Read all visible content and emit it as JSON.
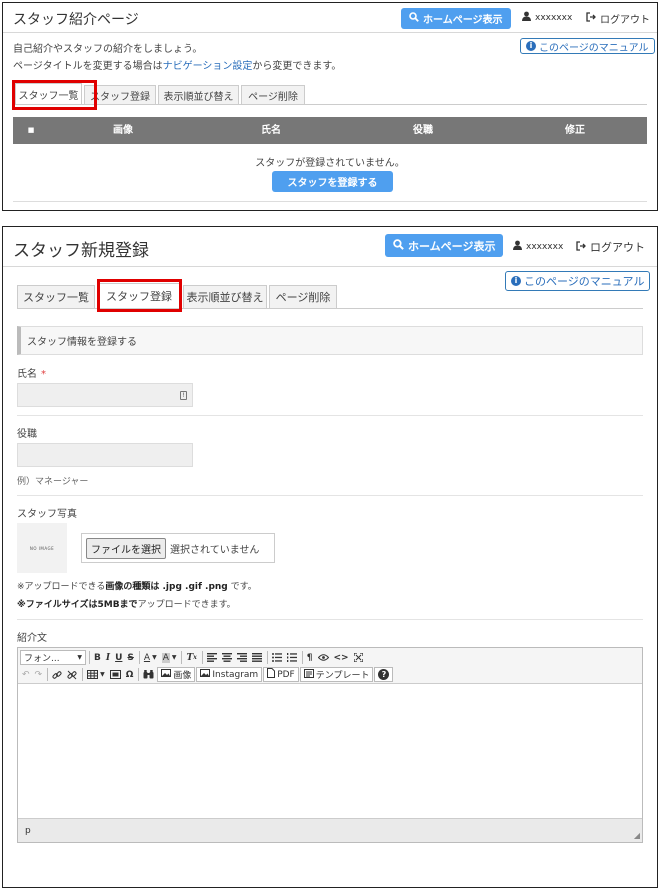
{
  "screen1": {
    "title": "スタッフ紹介ページ",
    "home_button": "ホームページ表示",
    "user": "xxxxxxx",
    "logout": "ログアウト",
    "manual": "このページのマニュアル",
    "desc1": "自己紹介やスタッフの紹介をしましょう。",
    "desc2_pre": "ページタイトルを変更する場合は",
    "desc2_link": "ナビゲーション設定",
    "desc2_post": "から変更できます。",
    "tabs": [
      "スタッフ一覧",
      "スタッフ登録",
      "表示順並び替え",
      "ページ削除"
    ],
    "active_tab": "スタッフ一覧",
    "table_headers": [
      "■",
      "画像",
      "氏名",
      "役職",
      "修正"
    ],
    "empty_message": "スタッフが登録されていません。",
    "register_button": "スタッフを登録する"
  },
  "screen2": {
    "title": "スタッフ新規登録",
    "home_button": "ホームページ表示",
    "user": "xxxxxxx",
    "logout": "ログアウト",
    "manual": "このページのマニュアル",
    "tabs": [
      "スタッフ一覧",
      "スタッフ登録",
      "表示順並び替え",
      "ページ削除"
    ],
    "active_tab": "スタッフ登録",
    "section_title": "スタッフ情報を登録する",
    "name_label": "氏名",
    "required_mark": "*",
    "name_value": "",
    "position_label": "役職",
    "position_value": "",
    "position_example": "例）マネージャー",
    "photo_label": "スタッフ写真",
    "no_image": "NO IMAGE",
    "file_button": "ファイルを選択",
    "file_status": "選択されていません",
    "note1": {
      "pre": "※アップロードできる",
      "bold": "画像の種類は .jpg .gif .png",
      "post": " です。"
    },
    "note2": {
      "bold": "※ファイルサイズは5MBまで",
      "post": "アップロードできます。"
    },
    "bio_label": "紹介文",
    "editor": {
      "font_select": "フォン...",
      "text_color": "A",
      "bg_color": "A",
      "image": "画像",
      "instagram": "Instagram",
      "pdf": "PDF",
      "template": "テンプレート",
      "status_path": "p"
    }
  },
  "colors": {
    "primary": "#4f9fef",
    "link": "#2a6ebb",
    "table_header": "#777777",
    "highlight": "#e00000",
    "required": "#e04040"
  }
}
